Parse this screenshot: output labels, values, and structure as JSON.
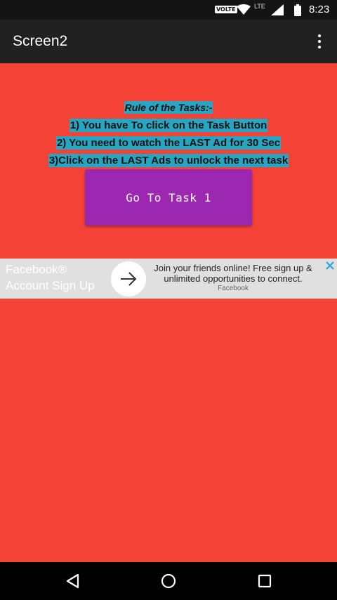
{
  "status_bar": {
    "volte": "VOLTE",
    "network": "LTE",
    "time": "8:23"
  },
  "app_bar": {
    "title": "Screen2"
  },
  "rules": {
    "heading": "Rule of the Tasks:-",
    "items": [
      "1)  You have To click on the Task Button",
      "2) You need to watch the LAST Ad for 30 Sec",
      "3)Click on the LAST Ads to unlock the next task"
    ]
  },
  "task_button": {
    "label": "Go To Task 1"
  },
  "ad": {
    "title": "Facebook® Account Sign Up",
    "description": "Join your friends online! Free sign up & unlimited opportunities to connect.",
    "source": "Facebook"
  },
  "colors": {
    "background": "#f44336",
    "app_bar": "#212121",
    "button": "#9c27b0",
    "rule_highlight": "#26a6c2",
    "ad_background": "#e0e0e0",
    "ad_close": "#29a8d8"
  },
  "icons": {
    "wifi": "wifi-icon",
    "signal": "signal-icon",
    "battery": "battery-icon",
    "overflow": "more-vert-icon",
    "ad_arrow": "arrow-right-icon",
    "ad_close": "close-icon",
    "nav_back": "back-icon",
    "nav_home": "home-icon",
    "nav_recents": "recents-icon"
  }
}
